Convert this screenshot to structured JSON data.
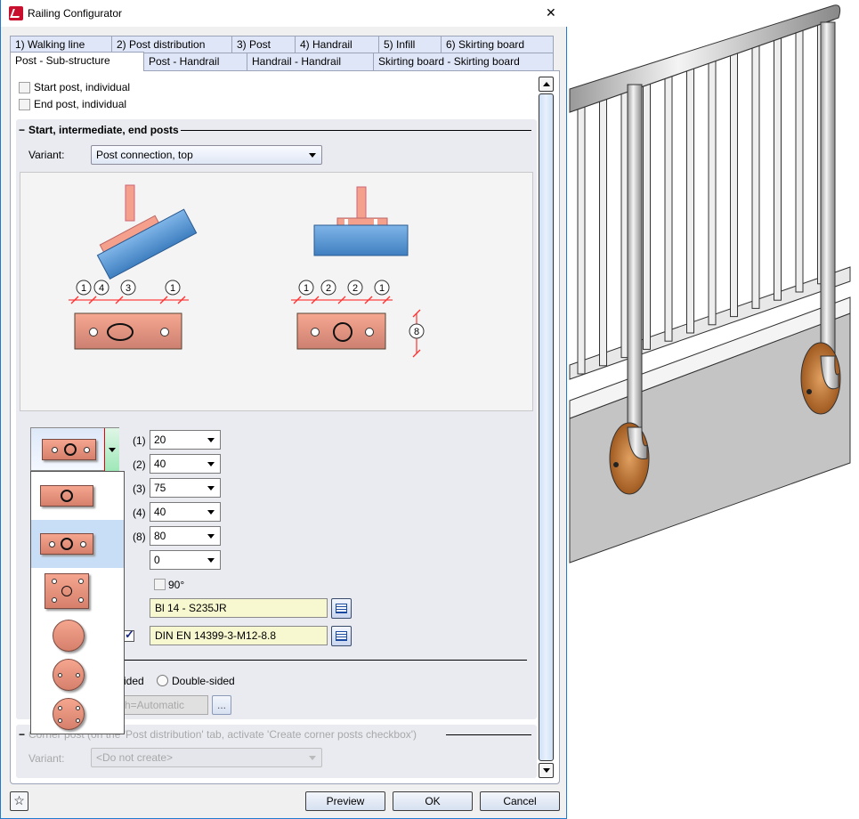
{
  "window": {
    "title": "Railing Configurator",
    "close": "✕"
  },
  "tabs_row1": [
    {
      "label": "1) Walking line"
    },
    {
      "label": "2) Post distribution"
    },
    {
      "label": "3) Post"
    },
    {
      "label": "4) Handrail"
    },
    {
      "label": "5) Infill"
    },
    {
      "label": "6) Skirting board"
    }
  ],
  "tabs_row2": [
    {
      "label": "Post - Sub-structure",
      "active": true
    },
    {
      "label": "Post - Handrail"
    },
    {
      "label": "Handrail - Handrail"
    },
    {
      "label": "Skirting board - Skirting board"
    }
  ],
  "checkboxes": {
    "start_post": {
      "label": "Start post, individual",
      "checked": false
    },
    "end_post": {
      "label": "End post, individual",
      "checked": false
    }
  },
  "posts_group": {
    "title": "Start, intermediate, end posts",
    "variant_label": "Variant:",
    "variant_value": "Post connection, top",
    "diagram": {
      "left_dims": [
        "1",
        "4",
        "3",
        "1"
      ],
      "right_dims": [
        "1",
        "2",
        "2",
        "1"
      ],
      "height_dim": "8"
    },
    "plate_selector": {
      "selected_index": 1,
      "options": [
        "rect-1-hole",
        "rect-3-holes",
        "rect-5-holes",
        "circle-solid",
        "circle-2-holes",
        "circle-4-holes"
      ]
    },
    "dimensions": [
      {
        "label": "(1)",
        "value": "20"
      },
      {
        "label": "(2)",
        "value": "40"
      },
      {
        "label": "(3)",
        "value": "75"
      },
      {
        "label": "(4)",
        "value": "40"
      },
      {
        "label": "(8)",
        "value": "80"
      },
      {
        "label": "",
        "value": "0"
      }
    ],
    "rotate_90": {
      "label": "90°",
      "checked": false
    },
    "material": "Bl 14 - S235JR",
    "bolt": {
      "checked": true,
      "value": "DIN EN 14399-3-M12-8.8"
    },
    "sided_partial": "ided",
    "double_sided": "Double-sided",
    "length_partial": "h=Automatic",
    "ellipsis": "..."
  },
  "corner_group": {
    "title": "Corner post (on the 'Post distribution' tab, activate 'Create corner posts checkbox')",
    "variant_label": "Variant:",
    "variant_value": "<Do not create>"
  },
  "footer": {
    "preview": "Preview",
    "ok": "OK",
    "cancel": "Cancel"
  },
  "colors": {
    "accent": "#0078d7",
    "plate": "#e8907a",
    "beam": "#5b9bd5",
    "dim": "#ff3030",
    "field_yellow": "#f8f8d0"
  }
}
